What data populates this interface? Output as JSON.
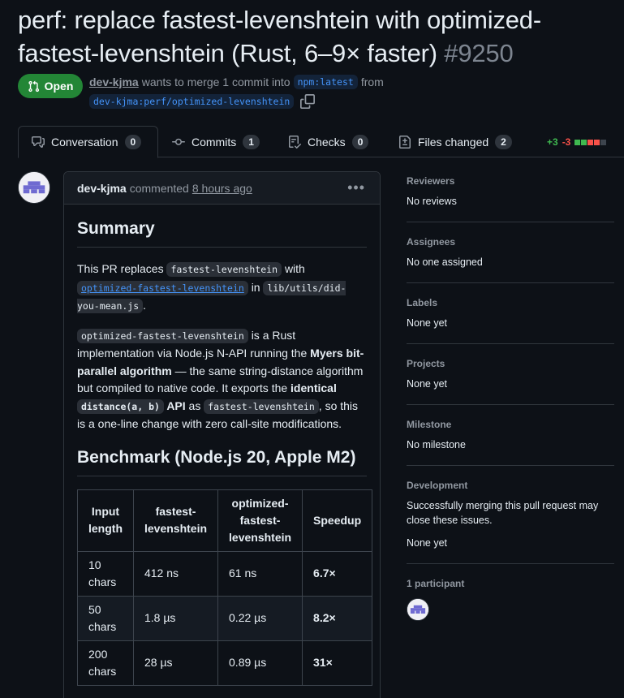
{
  "pr": {
    "title": "perf: replace fastest-levenshtein with optimized-fastest-levenshtein (Rust, 6–9× faster)",
    "number": "#9250",
    "state": "Open",
    "author": "dev-kjma",
    "merge_text": "wants to merge 1 commit into",
    "base_branch": "npm:latest",
    "from_text": "from",
    "head_branch": "dev-kjma:perf/optimized-levenshtein"
  },
  "tabs": [
    {
      "label": "Conversation",
      "count": "0",
      "icon": "comment-discussion-icon"
    },
    {
      "label": "Commits",
      "count": "1",
      "icon": "git-commit-icon"
    },
    {
      "label": "Checks",
      "count": "0",
      "icon": "checklist-icon"
    },
    {
      "label": "Files changed",
      "count": "2",
      "icon": "file-diff-icon"
    }
  ],
  "diffstat": {
    "additions": "+3",
    "deletions": "-3",
    "colors": {
      "add": "#3fb950",
      "del": "#f85149",
      "neutral": "#3d444d"
    }
  },
  "comment": {
    "author": "dev-kjma",
    "verb": "commented",
    "time": "8 hours ago",
    "menu_icon": "kebab-horizontal-icon",
    "summary_heading": "Summary",
    "p1_a": "This PR replaces",
    "p1_code1": "fastest-levenshtein",
    "p1_b": "with",
    "p1_link": "optimized-fastest-levenshtein",
    "p1_c": "in",
    "p1_code2": "lib/utils/did-you-mean.js",
    "p1_d": ".",
    "p2_code1": "optimized-fastest-levenshtein",
    "p2_a": "is a Rust implementation via Node.js N-API running the",
    "p2_bold1": "Myers bit-parallel algorithm",
    "p2_b": "— the same string-distance algorithm but compiled to native code. It exports the",
    "p2_bold2a": "identical",
    "p2_bold_code": "distance(a, b)",
    "p2_bold2b": "API",
    "p2_c": "as",
    "p2_code2": "fastest-levenshtein",
    "p2_d": ", so this is a one-line change with zero call-site modifications.",
    "bench_heading": "Benchmark (Node.js 20, Apple M2)",
    "table": {
      "headers": [
        "Input length",
        "fastest-levenshtein",
        "optimized-fastest-levenshtein",
        "Speedup"
      ],
      "rows": [
        [
          "10 chars",
          "412 ns",
          "61 ns",
          "6.7×"
        ],
        [
          "50 chars",
          "1.8 µs",
          "0.22 µs",
          "8.2×"
        ],
        [
          "200 chars",
          "28 µs",
          "0.89 µs",
          "31×"
        ]
      ]
    }
  },
  "sidebar": {
    "reviewers": {
      "heading": "Reviewers",
      "value": "No reviews"
    },
    "assignees": {
      "heading": "Assignees",
      "value": "No one assigned"
    },
    "labels": {
      "heading": "Labels",
      "value": "None yet"
    },
    "projects": {
      "heading": "Projects",
      "value": "None yet"
    },
    "milestone": {
      "heading": "Milestone",
      "value": "No milestone"
    },
    "development": {
      "heading": "Development",
      "value": "Successfully merging this pull request may close these issues.",
      "value2": "None yet"
    },
    "participants": {
      "heading": "1 participant"
    }
  }
}
